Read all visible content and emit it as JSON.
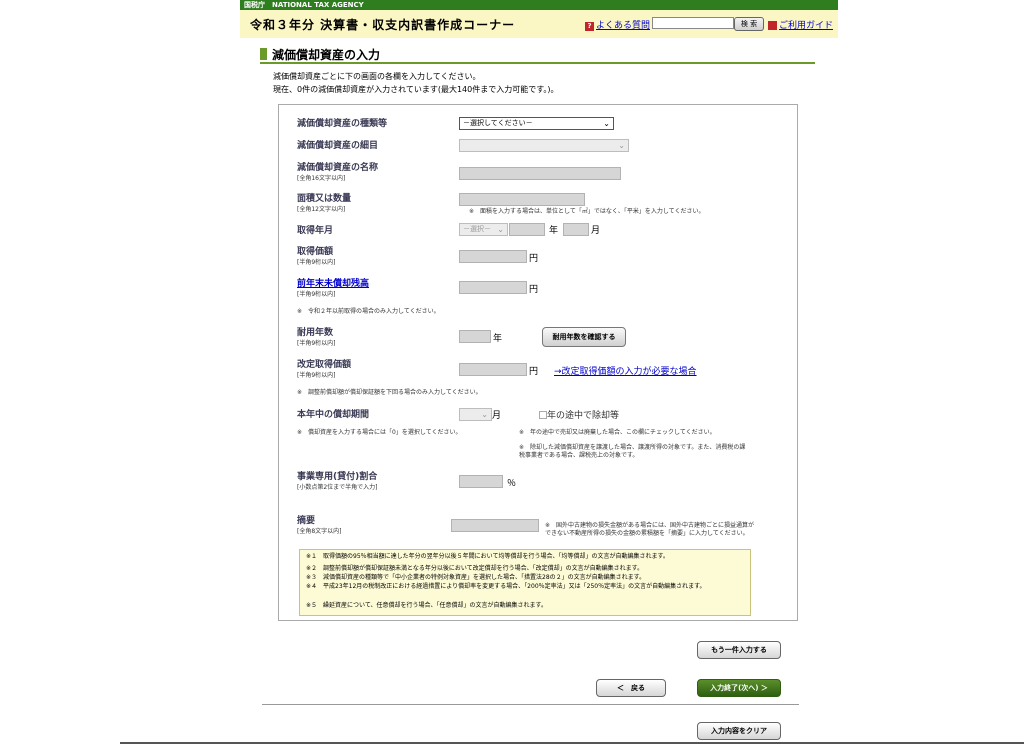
{
  "header": {
    "agency_name": "国税庁　NATIONAL TAX AGENCY",
    "corner_title": "令和３年分 決算書・収支内訳書作成コーナー",
    "faq_link": "よくある質問",
    "search_button": "検 索",
    "guide_link": "ご利用ガイド"
  },
  "section": {
    "title": "減価償却資産の入力",
    "intro_line1": "減価償却資産ごとに下の画面の各欄を入力してください。",
    "intro_line2": "現在、0件の減価償却資産が入力されています(最大140件まで入力可能です。)。"
  },
  "form": {
    "asset_type_label": "減価償却資産の種類等",
    "asset_type_select": "－選択してください－",
    "asset_detail_label": "減価償却資産の細目",
    "asset_name_label": "減価償却資産の名称",
    "asset_name_sub": "[全角16文字以内]",
    "area_label": "面積又は数量",
    "area_sub": "[全角12文字以内]",
    "area_note": "※　面積を入力する場合は、単位として「㎡」ではなく、「平米」を入力してください。",
    "acq_date_label": "取得年月",
    "acq_era_select": "－選択－",
    "year_unit": "年",
    "month_unit": "月",
    "acq_price_label": "取得価額",
    "acq_price_sub": "[半角9桁以内]",
    "yen_unit": "円",
    "prev_balance_label": "前年末未償却残高",
    "prev_balance_sub": "[半角9桁以内]",
    "prev_balance_note": "※　令和２年以前取得の場合のみ入力してください。",
    "useful_life_label": "耐用年数",
    "useful_life_sub": "[半角9桁以内]",
    "useful_life_unit": "年",
    "check_life_button": "耐用年数を確認する",
    "revised_price_label": "改定取得価額",
    "revised_price_sub": "[半角9桁以内]",
    "revised_price_link": "→改定取得価額の入力が必要な場合",
    "revised_price_note": "※　調整前償却額が償却保証額を下回る場合のみ入力してください。",
    "period_label": "本年中の償却期間",
    "period_unit": "月",
    "midyear_checkbox_label": "年の途中で除却等",
    "period_note": "※　償却資産を入力する場合には「0」を選択してください。",
    "midyear_note1": "※　年の途中で売却又は廃棄した場合、この欄にチェックしてください。",
    "midyear_note2": "※　除却した減価償却資産を譲渡した場合、譲渡所得の対象です。また、消費税の課税事業者である場合、課税売上の対象です。",
    "business_ratio_label": "事業専用(貸付)割合",
    "business_ratio_sub": "[小数点第2位まで半角で入力]",
    "percent_unit": "％",
    "summary_label": "摘要",
    "summary_sub": "[全角8文字以内]",
    "summary_note": "※　国外中古建物の損失金額がある場合には、国外中古建物ごとに損益通算ができない不動産所得の損失の金額の累積額を「摘要」に入力してください。"
  },
  "notes": [
    "※１　取得価額の95％相当額に達した年分の翌年分以後５年間において均等償却を行う場合、「均等償却」の文言が自動編集されます。",
    "※２　調整前償却額が償却保証額未満となる年分以後において改定償却を行う場合、「改定償却」の文言が自動編集されます。",
    "※３　減価償却資産の種類等で「中小企業者の特例対象資産」を選択した場合、「措置法28の２」の文言が自動編集されます。",
    "※４　平成23年12月の税制改正における経過措置により償却率を変更する場合、「200％定率法」又は「250％定率法」の文言が自動編集されます。",
    "※５　繰延資産について、任意償却を行う場合、「任意償却」の文言が自動編集されます。"
  ],
  "buttons": {
    "add_another": "もう一件入力する",
    "back": "＜　戻る",
    "finish": "入力終了(次へ) ＞",
    "clear": "入力内容をクリア"
  }
}
